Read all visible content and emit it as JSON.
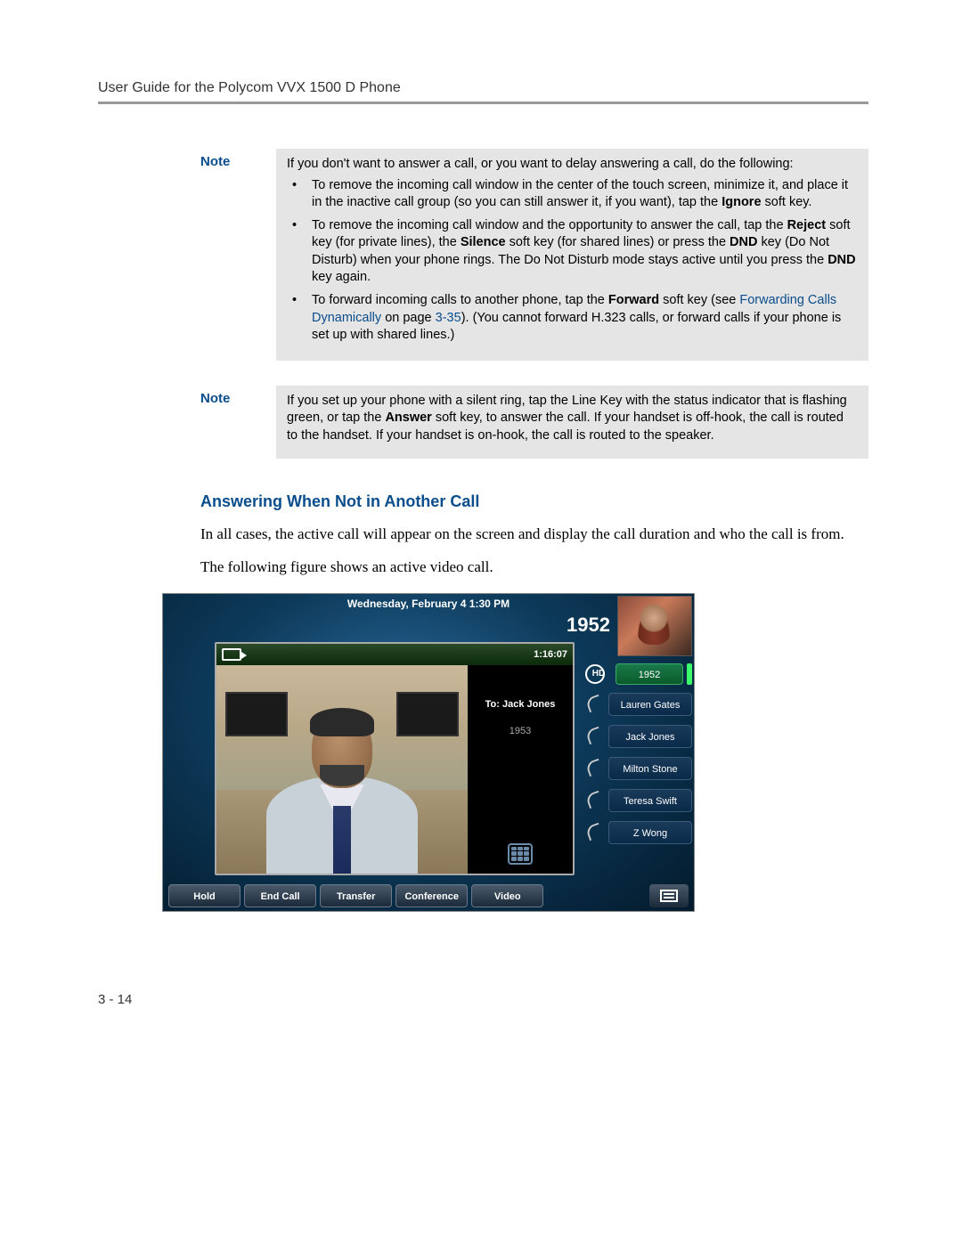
{
  "header": {
    "title": "User Guide for the Polycom VVX 1500 D Phone"
  },
  "notes": {
    "label": "Note",
    "note1_intro": "If you don't want to answer a call, or you want to delay answering a call, do the following:",
    "note1_b1_pre": "To remove the incoming call window in the center of the touch screen, minimize it, and place it in the inactive call group (so you can still answer it, if you want), tap the ",
    "note1_b1_bold": "Ignore",
    "note1_b1_post": " soft key.",
    "note1_b2_pre": "To remove the incoming call window and the opportunity to answer the call, tap the ",
    "note1_b2_b1": "Reject",
    "note1_b2_mid1": " soft key (for private lines), the ",
    "note1_b2_b2": "Silence",
    "note1_b2_mid2": " soft key (for shared lines) or press the ",
    "note1_b2_b3": "DND",
    "note1_b2_mid3": " key (Do Not Disturb) when your phone rings. The Do Not Disturb mode stays active until you press the ",
    "note1_b2_b4": "DND",
    "note1_b2_post": " key again.",
    "note1_b3_pre": "To forward incoming calls to another phone, tap the ",
    "note1_b3_b1": "Forward",
    "note1_b3_mid": " soft key (see ",
    "note1_b3_link": "Forwarding Calls Dynamically",
    "note1_b3_post1": " on page ",
    "note1_b3_page": "3-35",
    "note1_b3_post2": "). (You cannot forward H.323 calls, or forward calls if your phone is set up with shared lines.)",
    "note2_pre": "If you set up your phone with a silent ring, tap the Line Key with the status indicator that is flashing green, or tap the ",
    "note2_b1": "Answer",
    "note2_post": " soft key, to answer the call. If your handset is off-hook, the call is routed to the handset. If your handset is on-hook, the call is routed to the speaker."
  },
  "section": {
    "heading": "Answering When Not in Another Call",
    "p1": "In all cases, the active call will appear on the screen and display the call duration and who the call is from.",
    "p2": "The following figure shows an active video call."
  },
  "phone": {
    "datetime": "Wednesday, February 4  1:30 PM",
    "ext": "1952",
    "duration": "1:16:07",
    "to_label": "To: Jack Jones",
    "to_ext": "1953",
    "hd_label": "HD",
    "active_line": "1952",
    "contacts": [
      "Lauren Gates",
      "Jack Jones",
      "Milton Stone",
      "Teresa Swift",
      "Z Wong"
    ],
    "softkeys": [
      "Hold",
      "End Call",
      "Transfer",
      "Conference",
      "Video"
    ]
  },
  "footer": {
    "page": "3 - 14"
  }
}
